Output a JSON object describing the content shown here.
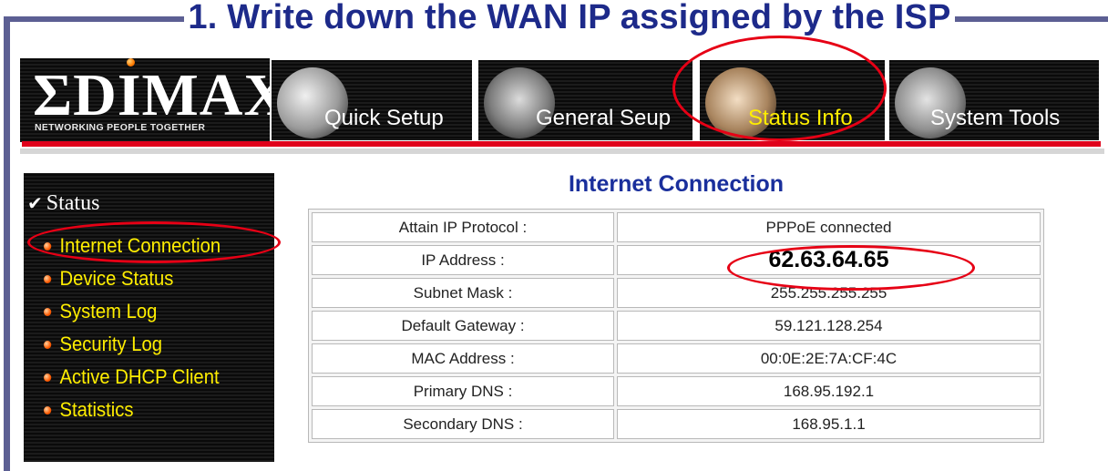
{
  "annotation": {
    "headline": "1. Write down the WAN IP assigned by the ISP",
    "highlight_color": "#e60015"
  },
  "brand": {
    "logo": "ΣDIMAX",
    "tagline": "NETWORKING PEOPLE TOGETHER"
  },
  "nav": {
    "tabs": [
      {
        "label": "Quick Setup",
        "icon": "quick-setup-icon",
        "active": false
      },
      {
        "label": "General Seup",
        "icon": "general-setup-icon",
        "active": false
      },
      {
        "label": "Status Info",
        "icon": "status-info-icon",
        "active": true
      },
      {
        "label": "System Tools",
        "icon": "system-tools-icon",
        "active": false
      }
    ],
    "active_color": "#ffee00"
  },
  "sidebar": {
    "heading": "Status",
    "heading_icon": "check-icon",
    "items": [
      {
        "label": "Internet Connection",
        "selected": true
      },
      {
        "label": "Device Status"
      },
      {
        "label": "System Log"
      },
      {
        "label": "Security Log"
      },
      {
        "label": "Active DHCP Client"
      },
      {
        "label": "Statistics"
      }
    ]
  },
  "content": {
    "title": "Internet Connection",
    "rows": [
      {
        "label": "Attain IP Protocol :",
        "value": "PPPoE connected"
      },
      {
        "label": "IP Address :",
        "value": "62.63.64.65"
      },
      {
        "label": "Subnet Mask :",
        "value": "255.255.255.255"
      },
      {
        "label": "Default Gateway :",
        "value": "59.121.128.254"
      },
      {
        "label": "MAC Address :",
        "value": "00:0E:2E:7A:CF:4C"
      },
      {
        "label": "Primary DNS :",
        "value": "168.95.192.1"
      },
      {
        "label": "Secondary DNS :",
        "value": "168.95.1.1"
      }
    ]
  }
}
